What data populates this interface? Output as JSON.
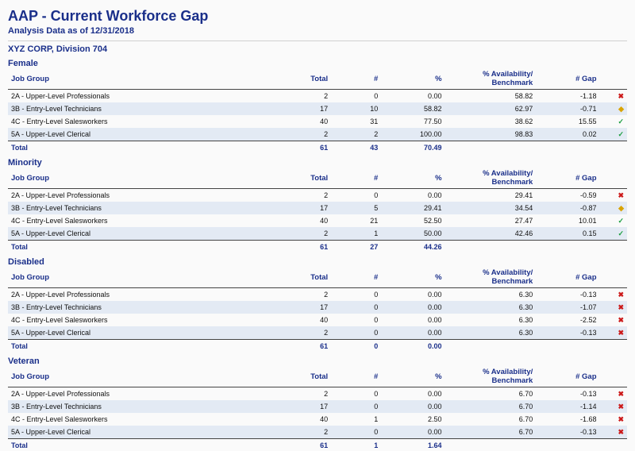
{
  "header": {
    "title": "AAP - Current Workforce Gap",
    "subtitle": "Analysis Data as of 12/31/2018",
    "org": "XYZ CORP, Division 704"
  },
  "columns": {
    "job_group": "Job Group",
    "total": "Total",
    "num": "#",
    "pct": "%",
    "availability": "% Availability/\nBenchmark",
    "gap": "# Gap"
  },
  "total_label": "Total",
  "marks": {
    "ok": "✓",
    "warn": "◆",
    "bad": "✖"
  },
  "groups": [
    {
      "name": "Female",
      "rows": [
        {
          "job_group": "2A - Upper-Level Professionals",
          "total": "2",
          "num": "0",
          "pct": "0.00",
          "availability": "58.82",
          "gap": "-1.18",
          "mark": "bad"
        },
        {
          "job_group": "3B - Entry-Level Technicians",
          "total": "17",
          "num": "10",
          "pct": "58.82",
          "availability": "62.97",
          "gap": "-0.71",
          "mark": "warn"
        },
        {
          "job_group": "4C - Entry-Level Salesworkers",
          "total": "40",
          "num": "31",
          "pct": "77.50",
          "availability": "38.62",
          "gap": "15.55",
          "mark": "ok"
        },
        {
          "job_group": "5A - Upper-Level Clerical",
          "total": "2",
          "num": "2",
          "pct": "100.00",
          "availability": "98.83",
          "gap": "0.02",
          "mark": "ok"
        }
      ],
      "total": {
        "total": "61",
        "num": "43",
        "pct": "70.49"
      }
    },
    {
      "name": "Minority",
      "rows": [
        {
          "job_group": "2A - Upper-Level Professionals",
          "total": "2",
          "num": "0",
          "pct": "0.00",
          "availability": "29.41",
          "gap": "-0.59",
          "mark": "bad"
        },
        {
          "job_group": "3B - Entry-Level Technicians",
          "total": "17",
          "num": "5",
          "pct": "29.41",
          "availability": "34.54",
          "gap": "-0.87",
          "mark": "warn"
        },
        {
          "job_group": "4C - Entry-Level Salesworkers",
          "total": "40",
          "num": "21",
          "pct": "52.50",
          "availability": "27.47",
          "gap": "10.01",
          "mark": "ok"
        },
        {
          "job_group": "5A - Upper-Level Clerical",
          "total": "2",
          "num": "1",
          "pct": "50.00",
          "availability": "42.46",
          "gap": "0.15",
          "mark": "ok"
        }
      ],
      "total": {
        "total": "61",
        "num": "27",
        "pct": "44.26"
      }
    },
    {
      "name": "Disabled",
      "rows": [
        {
          "job_group": "2A - Upper-Level Professionals",
          "total": "2",
          "num": "0",
          "pct": "0.00",
          "availability": "6.30",
          "gap": "-0.13",
          "mark": "bad"
        },
        {
          "job_group": "3B - Entry-Level Technicians",
          "total": "17",
          "num": "0",
          "pct": "0.00",
          "availability": "6.30",
          "gap": "-1.07",
          "mark": "bad"
        },
        {
          "job_group": "4C - Entry-Level Salesworkers",
          "total": "40",
          "num": "0",
          "pct": "0.00",
          "availability": "6.30",
          "gap": "-2.52",
          "mark": "bad"
        },
        {
          "job_group": "5A - Upper-Level Clerical",
          "total": "2",
          "num": "0",
          "pct": "0.00",
          "availability": "6.30",
          "gap": "-0.13",
          "mark": "bad"
        }
      ],
      "total": {
        "total": "61",
        "num": "0",
        "pct": "0.00"
      }
    },
    {
      "name": "Veteran",
      "rows": [
        {
          "job_group": "2A - Upper-Level Professionals",
          "total": "2",
          "num": "0",
          "pct": "0.00",
          "availability": "6.70",
          "gap": "-0.13",
          "mark": "bad"
        },
        {
          "job_group": "3B - Entry-Level Technicians",
          "total": "17",
          "num": "0",
          "pct": "0.00",
          "availability": "6.70",
          "gap": "-1.14",
          "mark": "bad"
        },
        {
          "job_group": "4C - Entry-Level Salesworkers",
          "total": "40",
          "num": "1",
          "pct": "2.50",
          "availability": "6.70",
          "gap": "-1.68",
          "mark": "bad"
        },
        {
          "job_group": "5A - Upper-Level Clerical",
          "total": "2",
          "num": "0",
          "pct": "0.00",
          "availability": "6.70",
          "gap": "-0.13",
          "mark": "bad"
        }
      ],
      "total": {
        "total": "61",
        "num": "1",
        "pct": "1.64"
      }
    }
  ]
}
